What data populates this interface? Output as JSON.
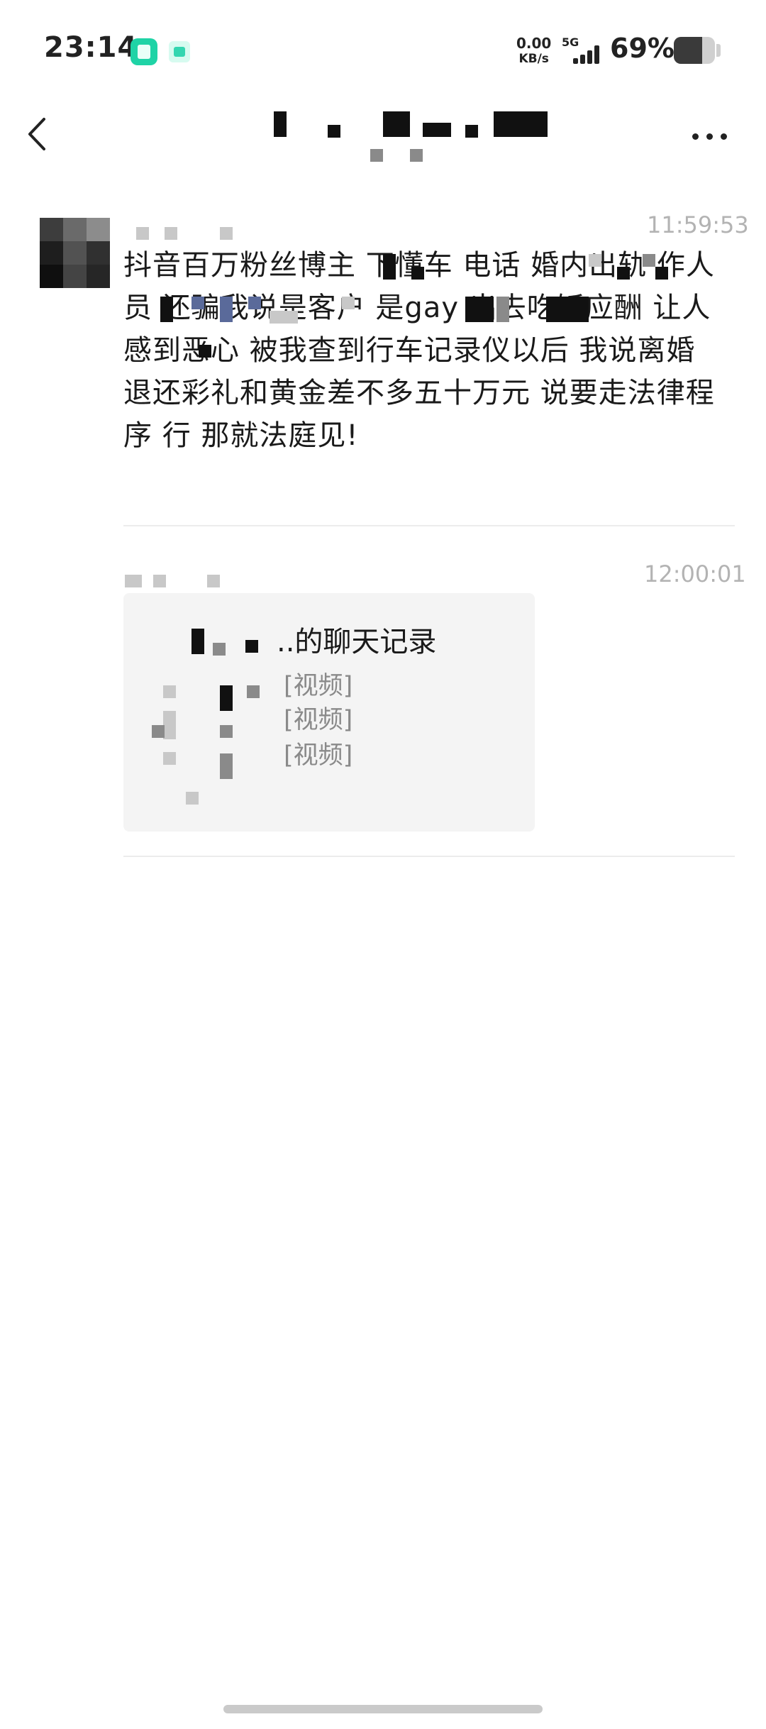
{
  "status_bar": {
    "time": "23:14",
    "net_speed_value": "0.00",
    "net_speed_unit": "KB/s",
    "network_type": "5G",
    "battery_percent": "69%",
    "battery_level": 0.69,
    "icons": [
      "app-notification-icon",
      "app-notification-icon-2",
      "signal-icon",
      "battery-icon"
    ]
  },
  "nav": {
    "back_icon": "chevron-left-icon",
    "more_icon": "more-horizontal-icon"
  },
  "messages": [
    {
      "timestamp": "11:59:53",
      "text": "抖音百万粉丝博主      下懂车        电话                  婚内出轨           作人员 还骗我说是客户 是gay 出去吃饭应酬 让人感到恶心 被我查到行车记录仪以后 我说离婚退还彩礼和黄金差不多五十万元 说要走法律程序 行 那就法庭见!"
    },
    {
      "timestamp": "12:00:01",
      "card": {
        "title": "..的聊天记录",
        "lines": [
          "[视频]",
          "[视频]",
          "[视频]"
        ]
      }
    }
  ],
  "colors": {
    "timestamp": "#b3b3b3",
    "card_bg": "#f4f4f4",
    "divider": "#ececec"
  }
}
